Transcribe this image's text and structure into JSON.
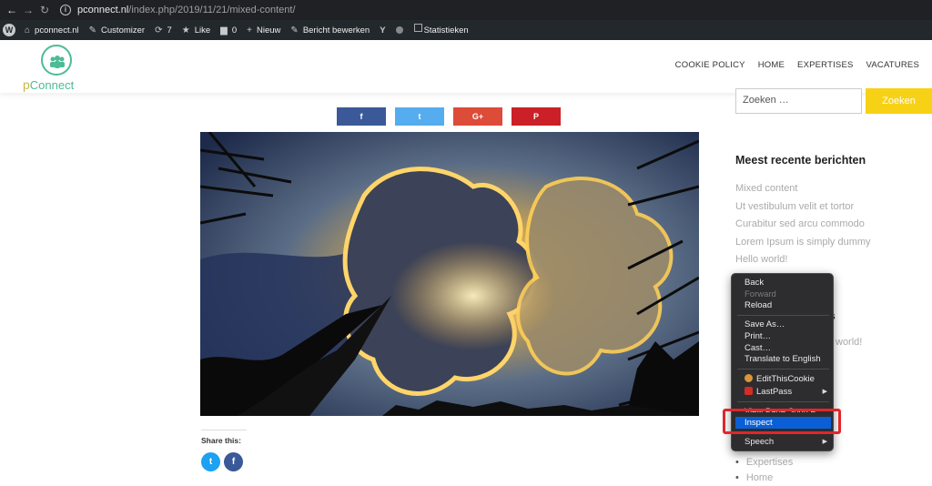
{
  "browser": {
    "url_host": "pconnect.nl",
    "url_path": "/index.php/2019/11/21/mixed-content/"
  },
  "adminbar": {
    "site": "pconnect.nl",
    "customizer": "Customizer",
    "updates": "7",
    "like": "Like",
    "comments": "0",
    "new": "Nieuw",
    "edit": "Bericht bewerken",
    "stats_alt": "Statistieken"
  },
  "site": {
    "logo_text_prefix": "p",
    "logo_text": "Connect",
    "nav": [
      "COOKIE POLICY",
      "HOME",
      "EXPERTISES",
      "VACATURES"
    ]
  },
  "share_buttons": [
    {
      "label": "f",
      "color": "#3b5998"
    },
    {
      "label": "t",
      "color": "#55acee"
    },
    {
      "label": "G+",
      "color": "#dd4b39"
    },
    {
      "label": "P",
      "color": "#cb2027"
    }
  ],
  "share_this": "Share this:",
  "share_circles": [
    {
      "label": "t",
      "color": "#1da1f2"
    },
    {
      "label": "f",
      "color": "#3b5998"
    }
  ],
  "sidebar": {
    "search_placeholder": "Zoeken …",
    "search_button": "Zoeken",
    "recent_title": "Meest recente berichten",
    "recent_posts": [
      "Mixed content",
      "Ut vestibulum velit et tortor",
      "Curabitur sed arcu commodo",
      "Lorem Ipsum is simply dummy",
      "Hello world!"
    ],
    "peek_heading_tail": "s",
    "peek_comment_tail": "world!",
    "categories": [
      "Expertises",
      "Home"
    ]
  },
  "context_menu": {
    "back": "Back",
    "forward": "Forward",
    "reload": "Reload",
    "save_as": "Save As…",
    "print": "Print…",
    "cast": "Cast…",
    "translate": "Translate to English",
    "editthiscookie": "EditThisCookie",
    "lastpass": "LastPass",
    "view_source": "View Page Source",
    "inspect": "Inspect",
    "speech": "Speech"
  },
  "colors": {
    "accent_green": "#4dbb97",
    "search_yellow": "#f7d116",
    "menu_highlight": "#0a5fd6",
    "annotation_red": "#e0262a"
  }
}
